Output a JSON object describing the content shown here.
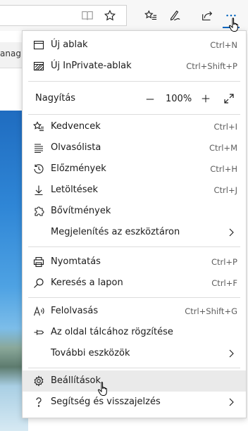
{
  "page_behind": {
    "text_fragment": "anag"
  },
  "menu": {
    "new_window": {
      "label": "Új ablak",
      "shortcut": "Ctrl+N"
    },
    "new_inprivate": {
      "label": "Új InPrivate-ablak",
      "shortcut": "Ctrl+Shift+P"
    },
    "zoom": {
      "label": "Nagyítás",
      "minus": "—",
      "value": "100%",
      "plus": "+"
    },
    "favorites": {
      "label": "Kedvencek",
      "shortcut": "Ctrl+I"
    },
    "reading_list": {
      "label": "Olvasólista",
      "shortcut": "Ctrl+M"
    },
    "history": {
      "label": "Előzmények",
      "shortcut": "Ctrl+H"
    },
    "downloads": {
      "label": "Letöltések",
      "shortcut": "Ctrl+J"
    },
    "extensions": {
      "label": "Bővítmények"
    },
    "show_in_toolbar": {
      "label": "Megjelenítés az eszköztáron"
    },
    "print": {
      "label": "Nyomtatás",
      "shortcut": "Ctrl+P"
    },
    "find": {
      "label": "Keresés a lapon",
      "shortcut": "Ctrl+F"
    },
    "read_aloud": {
      "label": "Felolvasás",
      "shortcut": "Ctrl+Shift+G"
    },
    "pin_taskbar": {
      "label": "Az oldal tálcához rögzítése"
    },
    "more_tools": {
      "label": "További eszközök"
    },
    "settings": {
      "label": "Beállítások"
    },
    "help": {
      "label": "Segítség és visszajelzés"
    }
  },
  "colors": {
    "accent": "#0067c0",
    "hover": "#eaeaea",
    "shortcut_text": "#5e5e5e"
  }
}
